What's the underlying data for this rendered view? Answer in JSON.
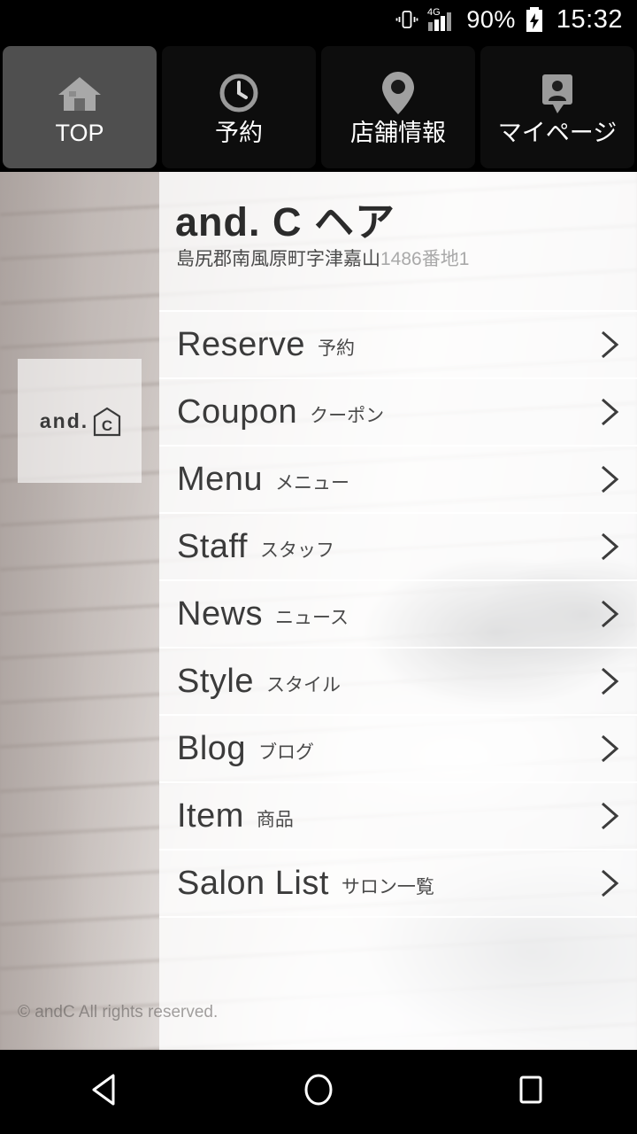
{
  "status_bar": {
    "vibrate_icon": "vibrate-icon",
    "network_label": "4G",
    "signal_icon": "signal-bars-icon",
    "battery_percent": "90%",
    "battery_icon": "battery-charging-icon",
    "time": "15:32"
  },
  "tabs": [
    {
      "label": "TOP",
      "icon": "home-icon",
      "active": true
    },
    {
      "label": "予約",
      "icon": "clock-icon",
      "active": false
    },
    {
      "label": "店舗情報",
      "icon": "map-pin-icon",
      "active": false
    },
    {
      "label": "マイページ",
      "icon": "account-icon",
      "active": false
    }
  ],
  "shop": {
    "logo_word": "and.",
    "logo_letter": "C",
    "title": "and. C ヘア",
    "address_main": "島尻郡南風原町字津嘉山",
    "address_dim": "1486番地1"
  },
  "menu": [
    {
      "en": "Reserve",
      "ja": "予約"
    },
    {
      "en": "Coupon",
      "ja": "クーポン"
    },
    {
      "en": "Menu",
      "ja": "メニュー"
    },
    {
      "en": "Staff",
      "ja": "スタッフ"
    },
    {
      "en": "News",
      "ja": "ニュース"
    },
    {
      "en": "Style",
      "ja": "スタイル"
    },
    {
      "en": "Blog",
      "ja": "ブログ"
    },
    {
      "en": "Item",
      "ja": "商品"
    },
    {
      "en": "Salon List",
      "ja": "サロン一覧"
    }
  ],
  "footer": {
    "copyright": "© andC All rights reserved."
  },
  "nav_bar": [
    {
      "name": "back-button",
      "icon": "triangle-back-icon"
    },
    {
      "name": "home-button",
      "icon": "circle-home-icon"
    },
    {
      "name": "recents-button",
      "icon": "square-recents-icon"
    }
  ],
  "colors": {
    "tab_active_bg": "#4f4f4f",
    "tab_bg": "#0d0d0d",
    "system_bg": "#000000",
    "panel_text": "#3b3b3b"
  }
}
